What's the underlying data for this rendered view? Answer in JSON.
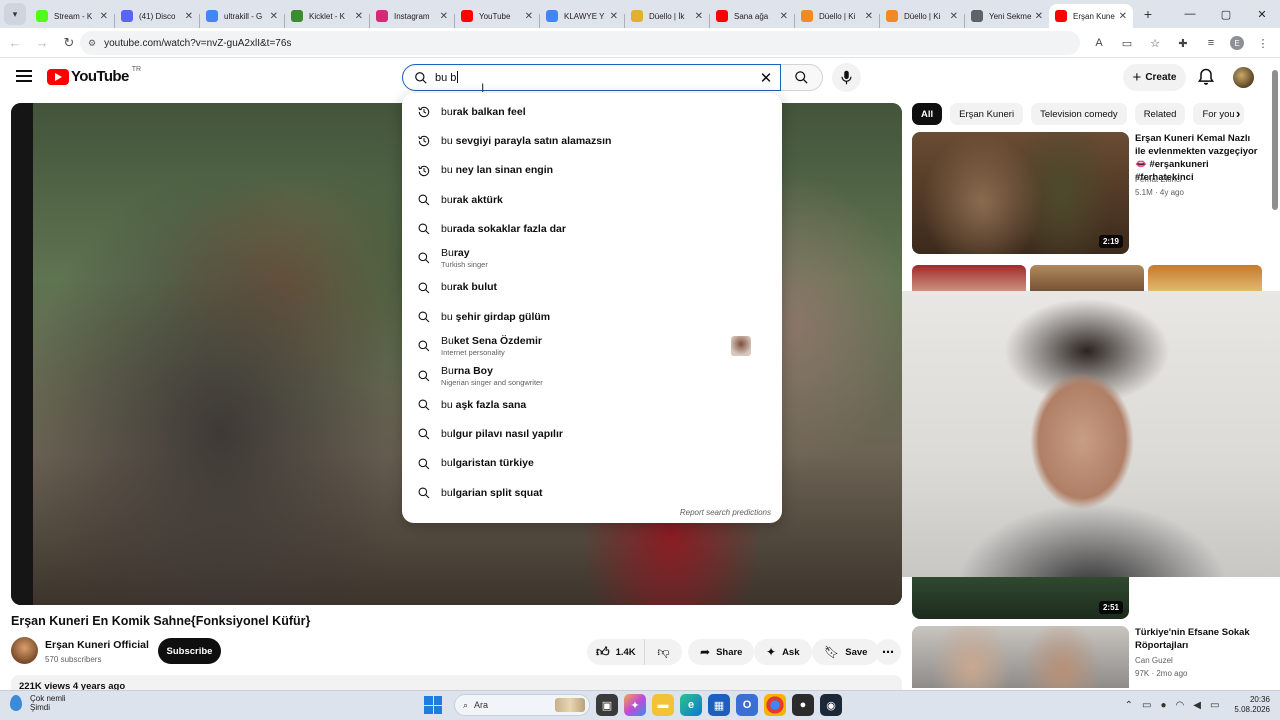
{
  "browser": {
    "tabs": [
      {
        "label": "Stream - K",
        "icon": "kick-icon",
        "color": "#53fc18"
      },
      {
        "label": "(41) Disco",
        "icon": "discord-icon",
        "color": "#5865f2"
      },
      {
        "label": "ultrakill - G",
        "icon": "google-icon",
        "color": "#4285f4"
      },
      {
        "label": "Kicklet - K",
        "icon": "kicklet-icon",
        "color": "#3a8c2f"
      },
      {
        "label": "Instagram",
        "icon": "instagram-icon",
        "color": "#d62976"
      },
      {
        "label": "YouTube",
        "icon": "youtube-icon",
        "color": "#ff0000"
      },
      {
        "label": "KLAWYE Y",
        "icon": "google-icon",
        "color": "#4285f4"
      },
      {
        "label": "Düello | İk",
        "icon": "duello-icon",
        "color": "#e0b030"
      },
      {
        "label": "Sana ağa",
        "icon": "youtube-icon",
        "color": "#ff0000"
      },
      {
        "label": "Düello | Ki",
        "icon": "duello-icon",
        "color": "#f08a24"
      },
      {
        "label": "Düello | Ki",
        "icon": "duello-icon",
        "color": "#f08a24"
      },
      {
        "label": "Yeni Sekme",
        "icon": "chrome-icon",
        "color": "#5f6368"
      },
      {
        "label": "Erşan Kune",
        "icon": "youtube-icon",
        "color": "#ff0000",
        "active": true
      }
    ],
    "url": "youtube.com/watch?v=nvZ-guA2xlI&t=76s",
    "profile_initial": "E"
  },
  "youtube": {
    "logo_text": "YouTube",
    "country_code": "TR",
    "search_query": "bu b",
    "create_label": "Create",
    "suggestions": [
      {
        "prefix": "bu",
        "rest": "rak balkan feel",
        "type": "history"
      },
      {
        "prefix": "bu",
        "rest": " sevgiyi parayla satın alamazsın",
        "type": "history"
      },
      {
        "prefix": "bu",
        "rest": " ney lan sinan engin",
        "type": "history"
      },
      {
        "prefix": "bu",
        "rest": "rak aktürk",
        "type": "search"
      },
      {
        "prefix": "bu",
        "rest": "rada sokaklar fazla dar",
        "type": "search"
      },
      {
        "prefix": "Bu",
        "rest": "ray",
        "type": "search",
        "sub": "Turkish singer"
      },
      {
        "prefix": "bu",
        "rest": "rak bulut",
        "type": "search"
      },
      {
        "prefix": "bu",
        "rest": " şehir girdap gülüm",
        "type": "search"
      },
      {
        "prefix": "Bu",
        "rest": "ket Sena Özdemir",
        "type": "search",
        "sub": "Internet personality",
        "thumb": true
      },
      {
        "prefix": "Bu",
        "rest": "rna Boy",
        "type": "search",
        "sub": "Nigerian singer and songwriter"
      },
      {
        "prefix": "bu",
        "rest": " aşk fazla sana",
        "type": "search"
      },
      {
        "prefix": "bu",
        "rest": "lgur pilavı nasıl yapılır",
        "type": "search"
      },
      {
        "prefix": "bu",
        "rest": "lgaristan türkiye",
        "type": "search"
      },
      {
        "prefix": "bu",
        "rest": "lgarian split squat",
        "type": "search"
      }
    ],
    "report_label": "Report search predictions",
    "video": {
      "title": "Erşan Kuneri En Komik Sahne{Fonksiyonel Küfür}",
      "channel": "Erşan Kuneri Official",
      "subscribers": "570 subscribers",
      "subscribe_label": "Subscribe",
      "likes": "1.4K",
      "share_label": "Share",
      "ask_label": "Ask",
      "save_label": "Save",
      "views_line": "221K views  4 years ago"
    },
    "chips": [
      "All",
      "Erşan Kuneri",
      "Television comedy",
      "Related",
      "For you"
    ],
    "recommended": [
      {
        "title": "Erşan Kuneri Kemal Nazlı ile evlenmekten vazgeçiyor 👄 #erşankuneri #ferhatekinci",
        "channel": "Ferhat Ekinci",
        "meta": "5.1M · 4y ago",
        "duration": "2:19"
      },
      {
        "duration": "2:51"
      },
      {
        "title": "Türkiye'nin Efsane Sokak Röportajları",
        "channel": "Can Guzel",
        "meta": "97K · 2mo ago"
      }
    ]
  },
  "taskbar": {
    "weather_line1": "Çok nemli",
    "weather_line2": "Şimdi",
    "search_placeholder": "Ara",
    "time": "20:36",
    "date": "5.08.2026"
  }
}
